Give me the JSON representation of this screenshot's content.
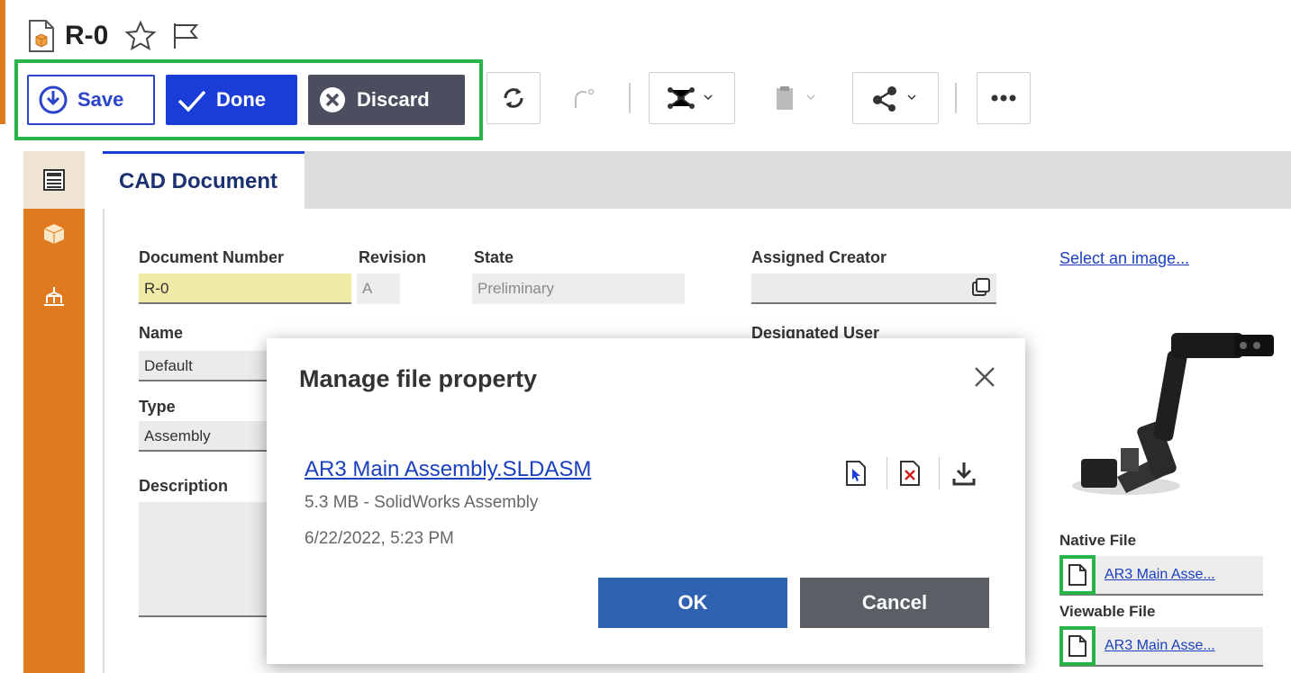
{
  "header": {
    "title": "R-0"
  },
  "toolbar": {
    "save_label": "Save",
    "done_label": "Done",
    "discard_label": "Discard"
  },
  "tabs": [
    {
      "label": "CAD Document"
    }
  ],
  "form": {
    "document_number": {
      "label": "Document Number",
      "value": "R-0"
    },
    "revision": {
      "label": "Revision",
      "value": "A"
    },
    "state": {
      "label": "State",
      "value": "Preliminary"
    },
    "assigned_creator": {
      "label": "Assigned Creator",
      "value": ""
    },
    "designated_user": {
      "label": "Designated User"
    },
    "name": {
      "label": "Name",
      "value": "Default"
    },
    "type": {
      "label": "Type",
      "value": "Assembly"
    },
    "description": {
      "label": "Description",
      "value": ""
    }
  },
  "side_panel": {
    "select_image_link": "Select an image...",
    "native_file": {
      "label": "Native File",
      "link": "AR3 Main Asse..."
    },
    "viewable_file": {
      "label": "Viewable File",
      "link": "AR3 Main Asse..."
    }
  },
  "modal": {
    "title": "Manage file property",
    "file_name": "AR3 Main Assembly.SLDASM",
    "file_meta": "5.3 MB - SolidWorks Assembly",
    "file_date": "6/22/2022, 5:23 PM",
    "ok_label": "OK",
    "cancel_label": "Cancel"
  },
  "colors": {
    "accent_orange": "#e07a1f",
    "primary_blue": "#1a3dd8",
    "discard_gray": "#4a4e5e",
    "highlight_green": "#28b44a",
    "ok_blue": "#2f62b0",
    "cancel_gray": "#5a5f66"
  }
}
